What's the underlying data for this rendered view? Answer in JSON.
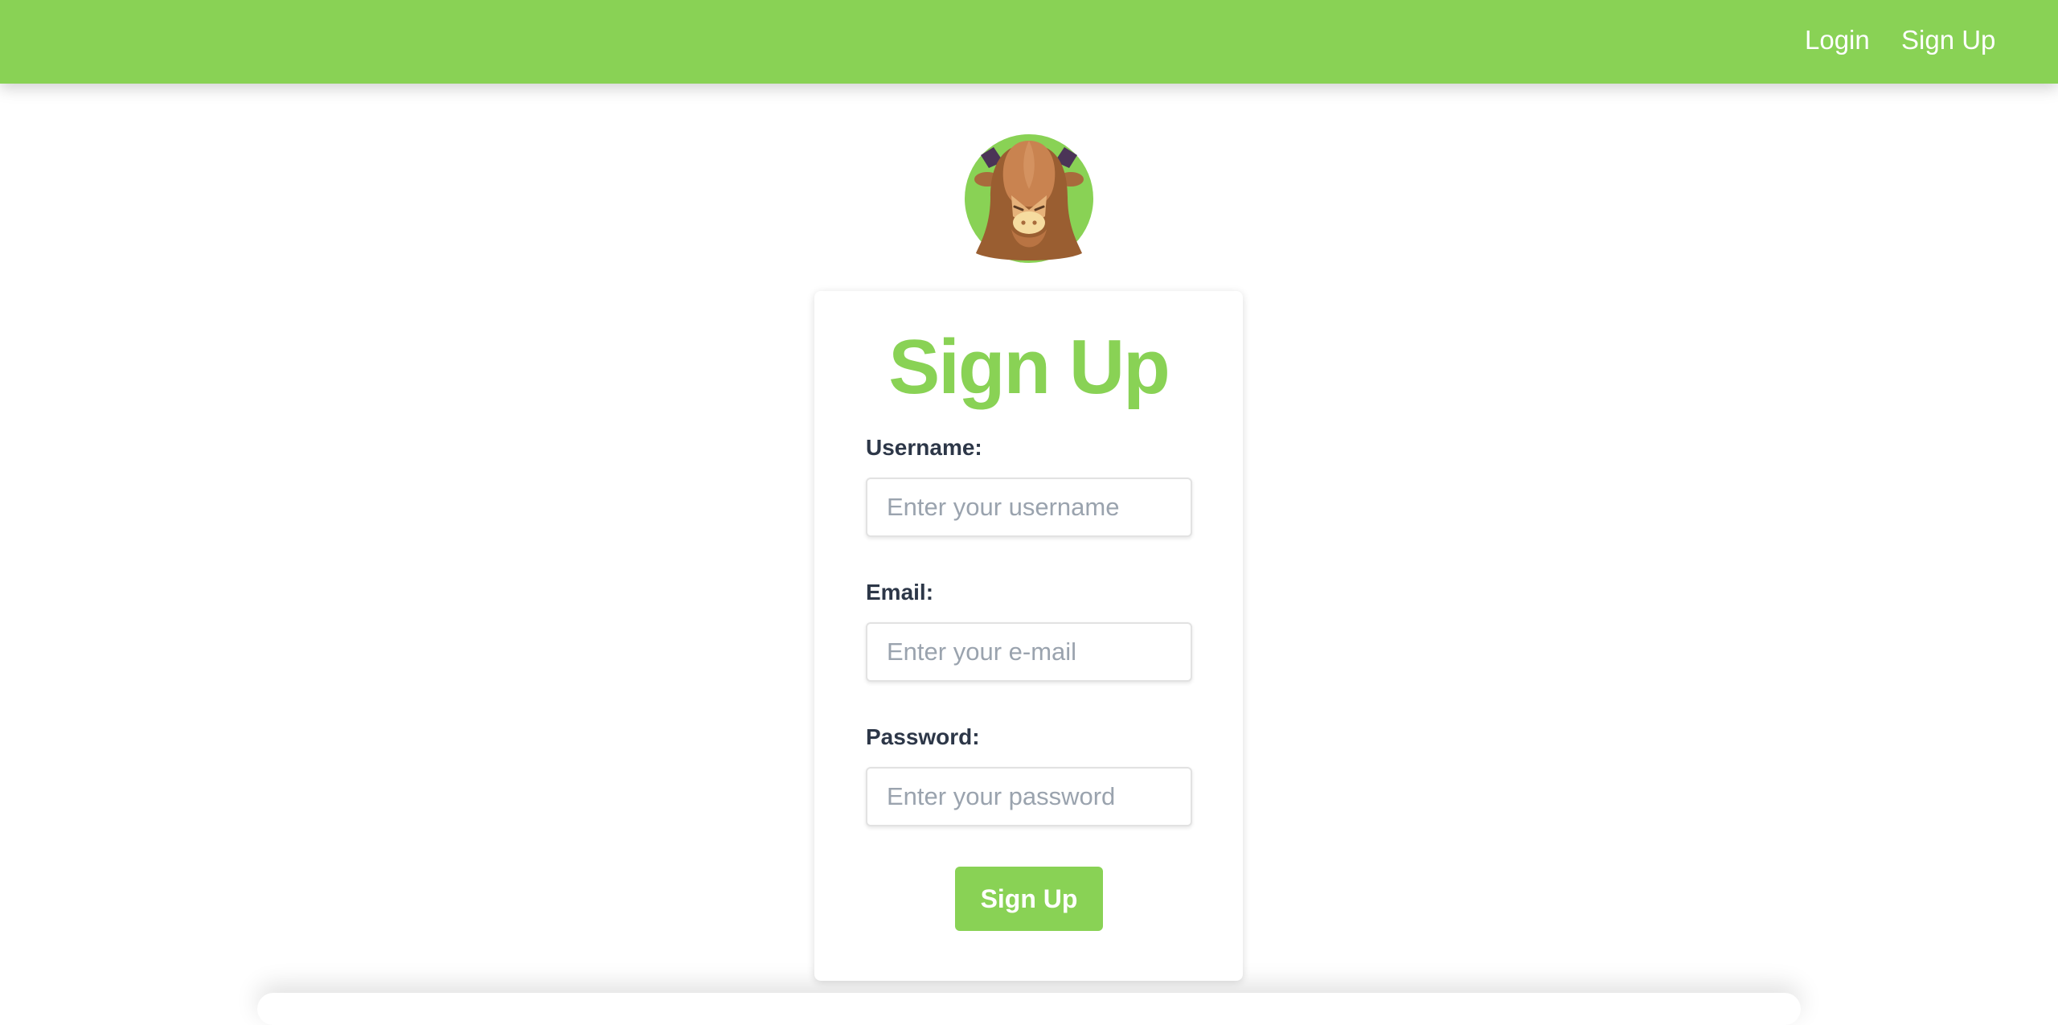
{
  "nav": {
    "login_label": "Login",
    "signup_label": "Sign Up"
  },
  "brand": {
    "accent_color": "#89d255",
    "logo_icon": "yak-avatar-icon"
  },
  "form": {
    "title": "Sign Up",
    "username": {
      "label": "Username:",
      "placeholder": "Enter your username",
      "value": ""
    },
    "email": {
      "label": "Email:",
      "placeholder": "Enter your e-mail",
      "value": ""
    },
    "password": {
      "label": "Password:",
      "placeholder": "Enter your password",
      "value": ""
    },
    "submit_label": "Sign Up"
  }
}
